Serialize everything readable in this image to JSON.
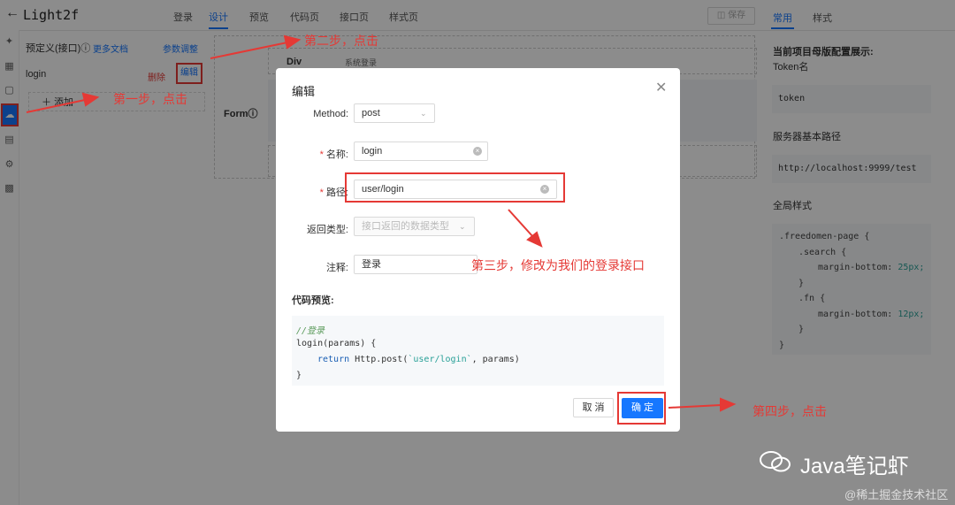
{
  "header": {
    "title": "Light2f",
    "tabs": [
      "登录",
      "设计",
      "预览",
      "代码页",
      "接口页",
      "样式页"
    ],
    "active_tab": "设计",
    "save_label": "保存",
    "right_tabs": [
      "常用",
      "样式"
    ]
  },
  "left_panel": {
    "title": "预定义(接口)",
    "doc_link": "更多文档",
    "param_link": "参数调整",
    "items": [
      {
        "name": "login",
        "delete": "删除",
        "edit": "编辑"
      }
    ],
    "add_label": "添加"
  },
  "canvas": {
    "div_label": "Div",
    "sys_label": "系统登录",
    "form_label": "Form"
  },
  "right_panel": {
    "heading": "当前项目母版配置展示:",
    "token_label": "Token名",
    "token_value": "token",
    "server_label": "服务器基本路径",
    "server_value": "http://localhost:9999/test",
    "style_label": "全局样式",
    "css_lines": [
      {
        "indent": 0,
        "sel": ".freedomen-page {"
      },
      {
        "indent": 1,
        "sel": ".search {"
      },
      {
        "indent": 2,
        "prop": "margin-bottom: ",
        "val": "25px;"
      },
      {
        "indent": 1,
        "sel": "}"
      },
      {
        "indent": 1,
        "sel": ".fn {"
      },
      {
        "indent": 2,
        "prop": "margin-bottom: ",
        "val": "12px;"
      },
      {
        "indent": 1,
        "sel": "}"
      },
      {
        "indent": 0,
        "sel": "}"
      }
    ]
  },
  "modal": {
    "title": "编辑",
    "method_label": "Method:",
    "method_value": "post",
    "name_label": "名称:",
    "name_value": "login",
    "path_label": "路径:",
    "path_value": "user/login",
    "return_label": "返回类型:",
    "return_placeholder": "接口返回的数据类型",
    "note_label": "注释:",
    "note_value": "登录",
    "preview_label": "代码预览:",
    "code_comment": "//登录",
    "code_fn": "login(params) {",
    "code_return_kw": "return",
    "code_return_a": " Http.post(",
    "code_return_str": "`user/login`",
    "code_return_b": ", params)",
    "code_close": "}",
    "cancel_label": "取 消",
    "ok_label": "确 定"
  },
  "annotations": {
    "step1": "第一步，点击",
    "step2": "第二步，点击",
    "step3": "第三步，修改为我们的登录接口",
    "step4": "第四步，点击"
  },
  "watermark": {
    "name": "Java笔记虾",
    "site": "@稀土掘金技术社区"
  },
  "colors": {
    "accent": "#1677ff",
    "annotation": "#e53935"
  }
}
